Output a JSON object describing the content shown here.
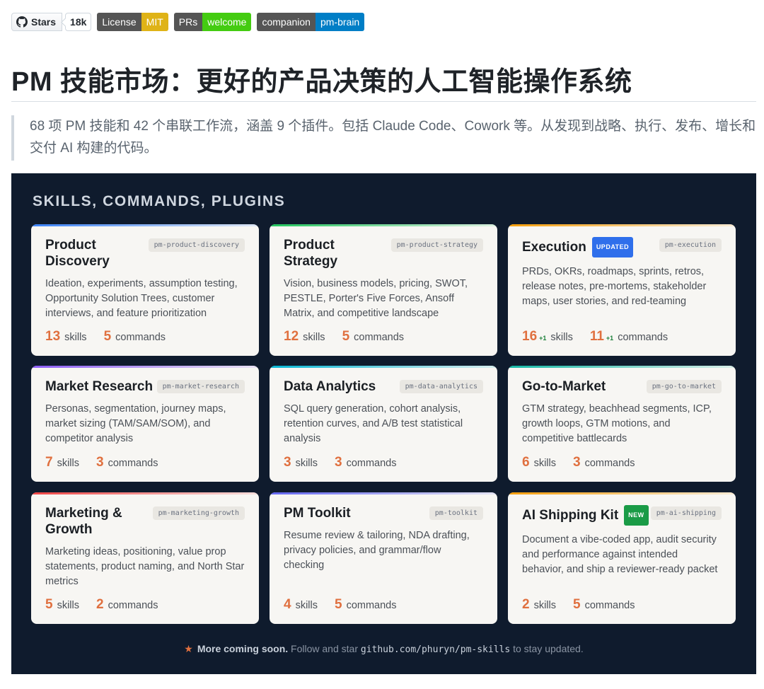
{
  "badges": {
    "stars_label": "Stars",
    "stars_count": "18k",
    "license": {
      "key": "License",
      "value": "MIT",
      "color": "#dfb317"
    },
    "prs": {
      "key": "PRs",
      "value": "welcome",
      "color": "#4c1"
    },
    "companion": {
      "key": "companion",
      "value": "pm-brain",
      "color": "#007ec6"
    }
  },
  "title": "PM 技能市场：更好的产品决策的人工智能操作系统",
  "description": "68 项 PM 技能和 42 个串联工作流，涵盖 9 个插件。包括 Claude Code、Cowork 等。从发现到战略、执行、发布、增长和交付 AI 构建的代码。",
  "panel": {
    "heading": "SKILLS, COMMANDS, PLUGINS",
    "skills_label": "skills",
    "commands_label": "commands",
    "cards": [
      {
        "name": "Product Discovery",
        "tag": "pm-product-discovery",
        "desc": "Ideation, experiments, assumption testing, Opportunity Solution Trees, customer interviews, and feature prioritization",
        "skills": "13",
        "commands": "5",
        "bar": "#3b82f6"
      },
      {
        "name": "Product Strategy",
        "tag": "pm-product-strategy",
        "desc": "Vision, business models, pricing, SWOT, PESTLE, Porter's Five Forces, Ansoff Matrix, and competitive landscape",
        "skills": "12",
        "commands": "5",
        "bar": "#22c55e"
      },
      {
        "name": "Execution",
        "badge": "UPDATED",
        "badge_color": "#2f6feb",
        "tag": "pm-execution",
        "desc": "PRDs, OKRs, roadmaps, sprints, retros, release notes, pre-mortems, stakeholder maps, user stories, and red-teaming",
        "skills": "16",
        "skills_delta": "+1",
        "commands": "11",
        "commands_delta": "+1",
        "bar": "#f59e0b"
      },
      {
        "name": "Market Research",
        "tag": "pm-market-research",
        "desc": "Personas, segmentation, journey maps, market sizing (TAM/SAM/SOM), and competitor analysis",
        "skills": "7",
        "commands": "3",
        "bar": "#8b5cf6"
      },
      {
        "name": "Data Analytics",
        "tag": "pm-data-analytics",
        "desc": "SQL query generation, cohort analysis, retention curves, and A/B test statistical analysis",
        "skills": "3",
        "commands": "3",
        "bar": "#06b6d4"
      },
      {
        "name": "Go-to-Market",
        "tag": "pm-go-to-market",
        "desc": "GTM strategy, beachhead segments, ICP, growth loops, GTM motions, and competitive battlecards",
        "skills": "6",
        "commands": "3",
        "bar": "#14b8a6"
      },
      {
        "name": "Marketing & Growth",
        "tag": "pm-marketing-growth",
        "desc": "Marketing ideas, positioning, value prop statements, product naming, and North Star metrics",
        "skills": "5",
        "commands": "2",
        "bar": "#ef4444"
      },
      {
        "name": "PM Toolkit",
        "tag": "pm-toolkit",
        "desc": "Resume review & tailoring, NDA drafting, privacy policies, and grammar/flow checking",
        "skills": "4",
        "commands": "5",
        "bar": "#6366f1"
      },
      {
        "name": "AI Shipping Kit",
        "badge": "NEW",
        "badge_color": "#1a9b46",
        "tag": "pm-ai-shipping",
        "desc": "Document a vibe-coded app, audit security and performance against intended behavior, and ship a reviewer-ready packet",
        "skills": "2",
        "commands": "5",
        "bar": "#f59e0b"
      }
    ],
    "footer": {
      "bold": "More coming soon.",
      "text_before": "Follow and star",
      "code": "github.com/phuryn/pm-skills",
      "text_after": "to stay updated."
    }
  }
}
